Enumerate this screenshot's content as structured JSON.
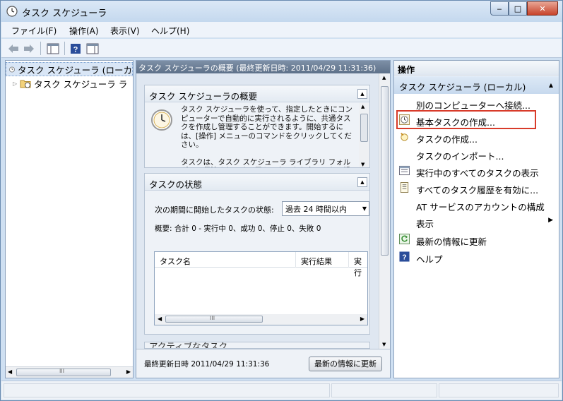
{
  "window": {
    "title": "タスク スケジューラ"
  },
  "caption": {
    "minimize": "‒",
    "maximize": "□",
    "close": "✕"
  },
  "menu": [
    "ファイル(F)",
    "操作(A)",
    "表示(V)",
    "ヘルプ(H)"
  ],
  "tree": {
    "items": [
      {
        "label": "タスク スケジューラ (ローカ",
        "selected": true
      },
      {
        "label": "タスク スケジューラ ラ",
        "selected": false
      }
    ],
    "scroll_grip": "III"
  },
  "center": {
    "header": "タスク スケジューラの概要 (最終更新日時: 2011/04/29 11:31:36)",
    "overview": {
      "title": "タスク スケジューラの概要",
      "text": "タスク スケジューラを使って、指定したときにコンピューターで自動的に実行されるように、共通タスクを作成し管理することができます。開始するには、[操作] メニューのコマンドをクリックしてください。",
      "text2": "タスクは、タスク スケジューラ ライブラリ フォルダーに保管されます。個々のタスクを表示または操作する"
    },
    "status": {
      "title": "タスクの状態",
      "period_label": "次の期間に開始したタスクの状態:",
      "period_value": "過去 24 時間以内",
      "summary": "概要: 合計 0 - 実行中 0、成功 0、停止 0、失敗 0",
      "columns": [
        "タスク名",
        "実行結果",
        "実行"
      ],
      "scroll_grip": "III"
    },
    "next_section": "アクティブなタスク",
    "footer": {
      "last_updated": "最終更新日時 2011/04/29 11:31:36",
      "refresh_button": "最新の情報に更新"
    }
  },
  "actions": {
    "header": "操作",
    "group": "タスク スケジューラ (ローカル)",
    "items": [
      {
        "label": "別のコンピューターへ接続...",
        "icon": "none"
      },
      {
        "label": "基本タスクの作成...",
        "icon": "clock-icon"
      },
      {
        "label": "タスクの作成...",
        "icon": "task-icon"
      },
      {
        "label": "タスクのインポート...",
        "icon": "none"
      },
      {
        "label": "実行中のすべてのタスクの表示",
        "icon": "list-icon"
      },
      {
        "label": "すべてのタスク履歴を有効に...",
        "icon": "history-icon"
      },
      {
        "label": "AT サービスのアカウントの構成",
        "icon": "none"
      },
      {
        "label": "表示",
        "icon": "none",
        "submenu": true
      },
      {
        "label": "最新の情報に更新",
        "icon": "refresh-icon"
      },
      {
        "label": "ヘルプ",
        "icon": "help-icon"
      }
    ]
  },
  "colors": {
    "highlight": "#d83b2a",
    "accent": "#c7d9ee"
  }
}
